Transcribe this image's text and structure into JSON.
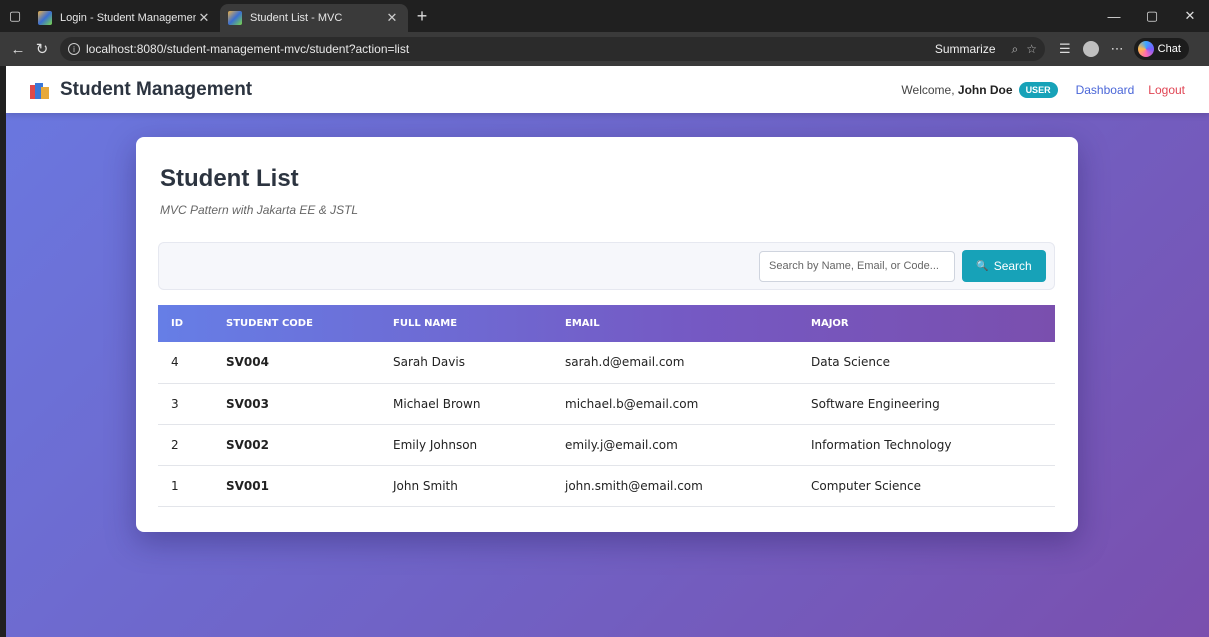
{
  "browser": {
    "tabs": [
      {
        "title": "Login - Student Management Sys",
        "active": false
      },
      {
        "title": "Student List - MVC",
        "active": true
      }
    ],
    "url": "localhost:8080/student-management-mvc/student?action=list",
    "summarize_label": "Summarize",
    "chat_label": "Chat"
  },
  "nav": {
    "brand": "Student Management",
    "welcome_prefix": "Welcome,",
    "user_name": "John Doe",
    "role": "USER",
    "links": {
      "dashboard": "Dashboard",
      "logout": "Logout"
    }
  },
  "page": {
    "title": "Student List",
    "subtitle": "MVC Pattern with Jakarta EE & JSTL"
  },
  "search": {
    "placeholder": "Search by Name, Email, or Code...",
    "button_label": "Search"
  },
  "table": {
    "columns": [
      "ID",
      "STUDENT CODE",
      "FULL NAME",
      "EMAIL",
      "MAJOR"
    ],
    "rows": [
      {
        "id": "4",
        "code": "SV004",
        "name": "Sarah Davis",
        "email": "sarah.d@email.com",
        "major": "Data Science"
      },
      {
        "id": "3",
        "code": "SV003",
        "name": "Michael Brown",
        "email": "michael.b@email.com",
        "major": "Software Engineering"
      },
      {
        "id": "2",
        "code": "SV002",
        "name": "Emily Johnson",
        "email": "emily.j@email.com",
        "major": "Information Technology"
      },
      {
        "id": "1",
        "code": "SV001",
        "name": "John Smith",
        "email": "john.smith@email.com",
        "major": "Computer Science"
      }
    ]
  },
  "colors": {
    "accent": "#17a2b8",
    "gradient_start": "#667ee6",
    "gradient_end": "#7a4fae",
    "logout": "#e04453",
    "link": "#4a66d8"
  }
}
